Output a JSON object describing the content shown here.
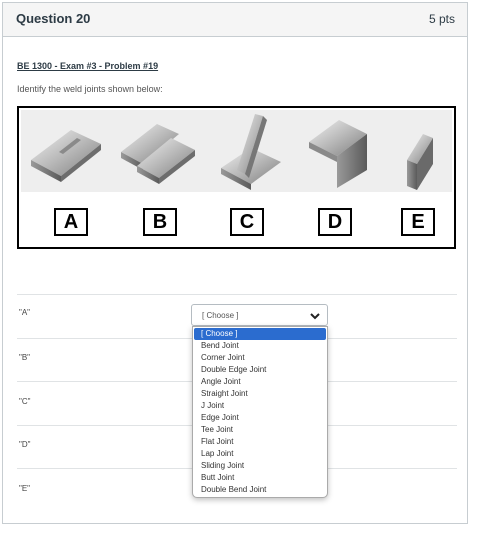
{
  "question": {
    "title": "Question 20",
    "points": "5 pts"
  },
  "problem_title": "BE 1300 - Exam #3 - Problem #19",
  "prompt": "Identify the weld joints shown below:",
  "figure_letters": [
    "A",
    "B",
    "C",
    "D",
    "E"
  ],
  "answer_rows": [
    {
      "label": "\"A\""
    },
    {
      "label": "\"B\""
    },
    {
      "label": "\"C\""
    },
    {
      "label": "\"D\""
    },
    {
      "label": "\"E\""
    }
  ],
  "select": {
    "value": "[ Choose ]"
  },
  "dropdown_options": [
    "[ Choose ]",
    "Bend Joint",
    "Corner Joint",
    "Double Edge Joint",
    "Angle Joint",
    "Straight Joint",
    "J Joint",
    "Edge Joint",
    "Tee Joint",
    "Flat Joint",
    "Lap Joint",
    "Sliding Joint",
    "Butt Joint",
    "Double Bend Joint"
  ],
  "colors": {
    "selected_option_bg": "#2b6ccf",
    "header_bg": "#f5f5f5",
    "border": "#c7cdd1"
  },
  "icons": {
    "select_chevron": "chevron-down-icon"
  }
}
